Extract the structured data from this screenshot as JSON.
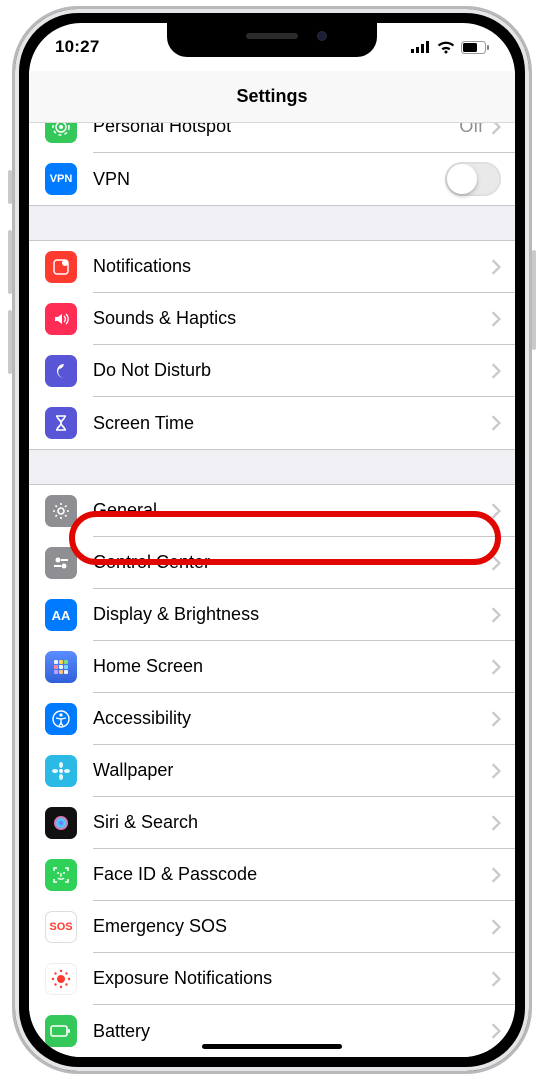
{
  "status": {
    "time": "10:27"
  },
  "header": {
    "title": "Settings"
  },
  "section0": {
    "hotspot": {
      "label": "Personal Hotspot",
      "detail": "Off"
    },
    "vpn": {
      "label": "VPN",
      "badge": "VPN"
    }
  },
  "section1": {
    "notifications": {
      "label": "Notifications"
    },
    "sounds": {
      "label": "Sounds & Haptics"
    },
    "dnd": {
      "label": "Do Not Disturb"
    },
    "screentime": {
      "label": "Screen Time"
    }
  },
  "section2": {
    "general": {
      "label": "General"
    },
    "controlcenter": {
      "label": "Control Center"
    },
    "display": {
      "label": "Display & Brightness",
      "badge": "AA"
    },
    "homescreen": {
      "label": "Home Screen"
    },
    "accessibility": {
      "label": "Accessibility"
    },
    "wallpaper": {
      "label": "Wallpaper"
    },
    "siri": {
      "label": "Siri & Search"
    },
    "faceid": {
      "label": "Face ID & Passcode"
    },
    "sos": {
      "label": "Emergency SOS",
      "badge": "SOS"
    },
    "exposure": {
      "label": "Exposure Notifications"
    },
    "battery": {
      "label": "Battery"
    }
  },
  "highlight": {
    "target": "general"
  }
}
